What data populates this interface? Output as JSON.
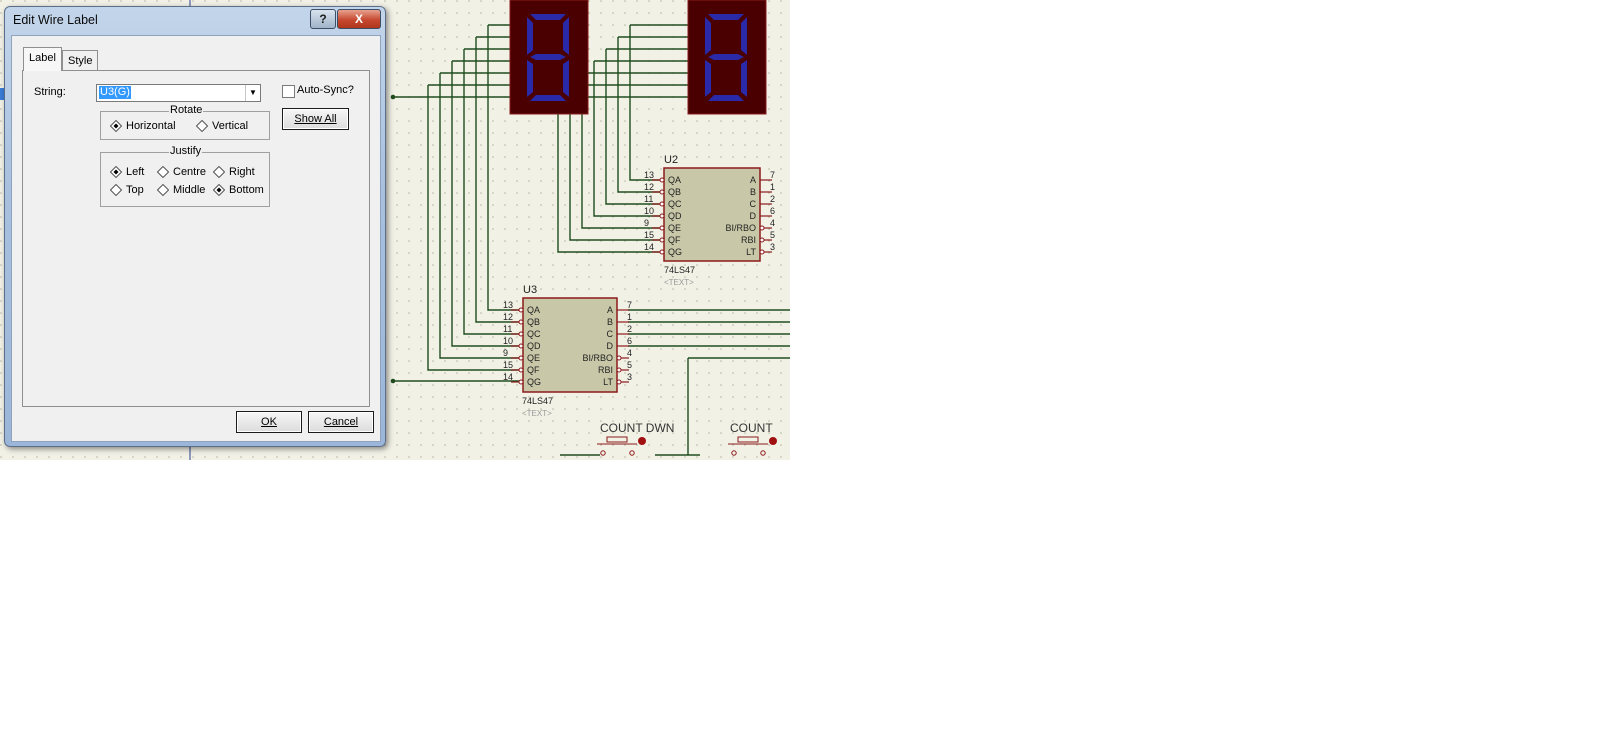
{
  "dialog": {
    "title": "Edit Wire Label",
    "help_label": "?",
    "close_label": "X",
    "tabs": [
      {
        "label": "Label"
      },
      {
        "label": "Style"
      }
    ],
    "string_label": "String:",
    "string_value": "U3(G)",
    "autosync_label": "Auto-Sync?",
    "rotate": {
      "title": "Rotate",
      "options": [
        "Horizontal",
        "Vertical"
      ],
      "selected": "Horizontal"
    },
    "justify": {
      "title": "Justify",
      "options": [
        "Left",
        "Centre",
        "Right",
        "Top",
        "Middle",
        "Bottom"
      ],
      "selected": [
        "Left",
        "Bottom"
      ]
    },
    "show_all_label": "Show All",
    "ok_label": "OK",
    "cancel_label": "Cancel"
  },
  "schematic": {
    "u2": {
      "ref": "U2",
      "part": "74LS47",
      "text": "<TEXT>",
      "left_pins": [
        {
          "num": "13",
          "name": "QA"
        },
        {
          "num": "12",
          "name": "QB"
        },
        {
          "num": "11",
          "name": "QC"
        },
        {
          "num": "10",
          "name": "QD"
        },
        {
          "num": "9",
          "name": "QE"
        },
        {
          "num": "15",
          "name": "QF"
        },
        {
          "num": "14",
          "name": "QG"
        }
      ],
      "right_pins": [
        {
          "num": "7",
          "name": "A"
        },
        {
          "num": "1",
          "name": "B"
        },
        {
          "num": "2",
          "name": "C"
        },
        {
          "num": "6",
          "name": "D"
        },
        {
          "num": "4",
          "name": "BI/RBO"
        },
        {
          "num": "5",
          "name": "RBI"
        },
        {
          "num": "3",
          "name": "LT"
        }
      ]
    },
    "u3": {
      "ref": "U3",
      "part": "74LS47",
      "text": "<TEXT>",
      "left_pins": [
        {
          "num": "13",
          "name": "QA"
        },
        {
          "num": "12",
          "name": "QB"
        },
        {
          "num": "11",
          "name": "QC"
        },
        {
          "num": "10",
          "name": "QD"
        },
        {
          "num": "9",
          "name": "QE"
        },
        {
          "num": "15",
          "name": "QF"
        },
        {
          "num": "14",
          "name": "QG"
        }
      ],
      "right_pins": [
        {
          "num": "7",
          "name": "A"
        },
        {
          "num": "1",
          "name": "B"
        },
        {
          "num": "2",
          "name": "C"
        },
        {
          "num": "6",
          "name": "D"
        },
        {
          "num": "4",
          "name": "BI/RBO"
        },
        {
          "num": "5",
          "name": "RBI"
        },
        {
          "num": "3",
          "name": "LT"
        }
      ]
    },
    "display_digit": "8",
    "buttons": [
      {
        "label": "COUNT DWN"
      },
      {
        "label": "COUNT"
      }
    ],
    "colors": {
      "canvas": "#f2f1e6",
      "chip_fill": "#c8c8a8",
      "chip_border": "#8b1a1a",
      "wire": "#1f4d1f",
      "display_bg": "#4a0000",
      "segment": "#2a2aa8"
    }
  }
}
